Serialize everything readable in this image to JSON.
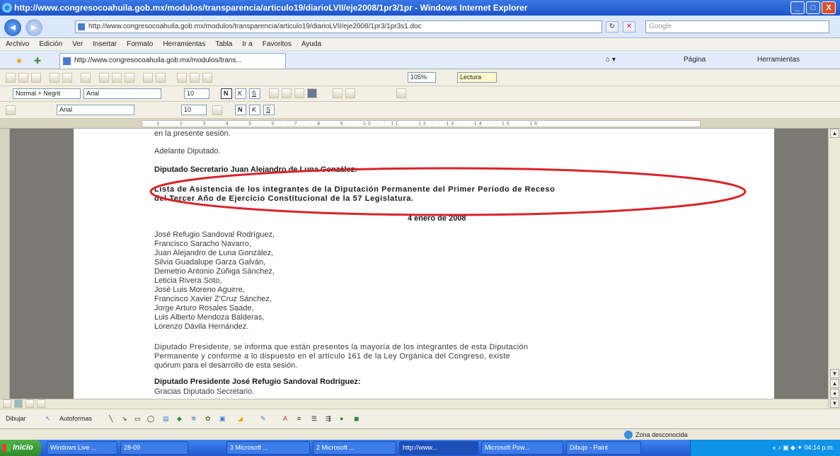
{
  "window": {
    "title": "http://www.congresocoahuila.gob.mx/modulos/transparencia/articulo19/diarioLVII/eje2008/1pr3/1pr - Windows Internet Explorer",
    "controls": {
      "minimize": "_",
      "maximize": "□",
      "close": "X"
    }
  },
  "address": {
    "url": "http://www.congresocoahuila.gob.mx/modulos/transparencia/articulo19/diarioLVII/eje2008/1pr3/1pr3s1.doc",
    "search_placeholder": "Google",
    "back": "◄",
    "forward": "►"
  },
  "menu": [
    "Archivo",
    "Edición",
    "Ver",
    "Insertar",
    "Formato",
    "Herramientas",
    "Tabla",
    "Ir a",
    "Favoritos",
    "Ayuda"
  ],
  "tab": {
    "label": "http://www.congresocoahuila.gob.mx/modulos/trans..."
  },
  "ie_commands": {
    "page": "Página",
    "tools": "Herramientas",
    "reading": "Lectura",
    "zoom": "105%"
  },
  "formatting": {
    "style": "Normal + Negrit",
    "font": "Arial",
    "size": "10",
    "font2": "Arial",
    "size2": "10",
    "bold": "N",
    "italic": "K",
    "underline": "S"
  },
  "document": {
    "lines": [
      "en la presente sesión.",
      "Adelante Diputado.",
      "Diputado Secretario Juan Alejandro de Luna González:",
      "Lista de Asistencia de los integrantes de la Diputación Permanente del Primer Período de Receso",
      "del Tercer Año de Ejercicio Constitucional de la 57 Legislatura.",
      "4 enero de 2008",
      "José Refugio Sandoval Rodríguez,",
      "Francisco Saracho Navarro,",
      "Juan Alejandro de Luna González,",
      "Silvia Guadalupe Garza Galván,",
      "Demetrio Antonio Zúñiga Sánchez,",
      "Leticia Rivera Soto,",
      "José Luis Moreno Aguirre,",
      "Francisco Xavier Z'Cruz Sánchez,",
      "Jorge Arturo Rosales Saade,",
      "Luis Alberto Mendoza Balderas,",
      "Lorenzo Dávila Hernández.",
      "Diputado Presidente, se informa que están presentes la mayoría de los integrantes de esta Diputación",
      "Permanente y conforme a lo dispuesto en el artículo 161 de la Ley Orgánica del Congreso, existe",
      "quórum para el desarrollo de esta sesión.",
      "Diputado Presidente José Refugio Sandoval Rodríguez:",
      "Gracias Diputado Secretario."
    ],
    "highlight_color": "#d8232a"
  },
  "drawing": {
    "draw": "Dibujar",
    "autoshapes": "Autoformas"
  },
  "status": {
    "zone": "Zona desconocida"
  },
  "taskbar": {
    "start": "Inicio",
    "items": [
      "Windows Live ...",
      "28-09",
      "3 Microsoft ...",
      "2 Microsoft ...",
      "http://www...",
      "Microsoft Pow...",
      "Dibujo - Paint"
    ],
    "clock": "04:14 p.m."
  }
}
